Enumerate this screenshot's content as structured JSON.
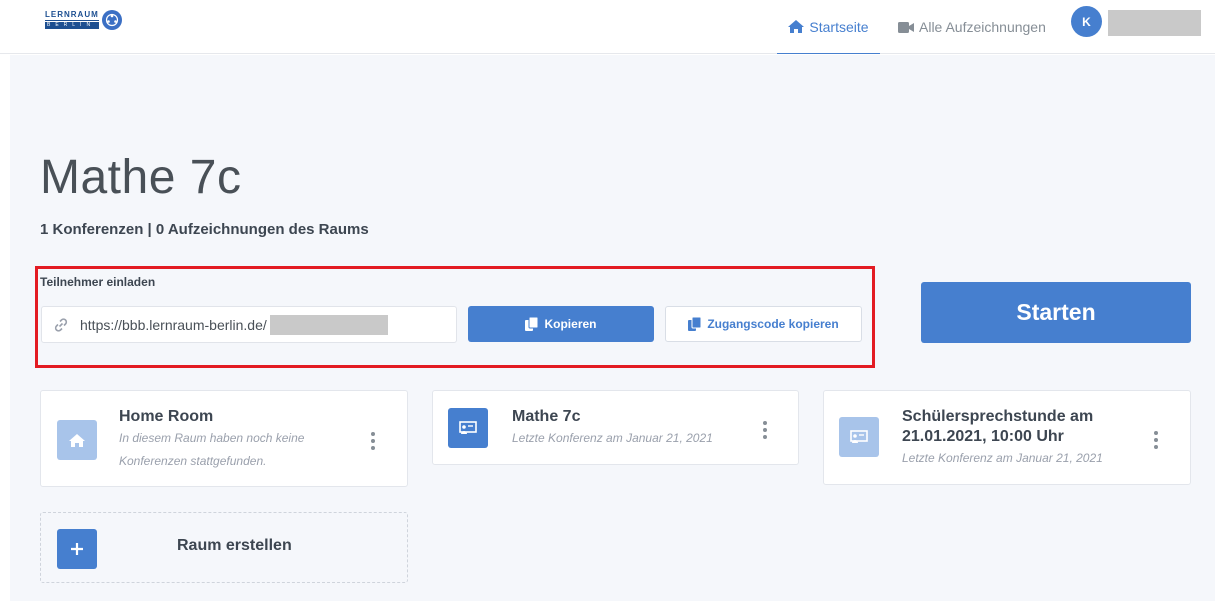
{
  "header": {
    "logo_main": "LERNRAUM",
    "logo_sub": "BERLIN",
    "nav_home_label": "Startseite",
    "nav_recordings_label": "Alle Aufzeichnungen",
    "avatar_initial": "K"
  },
  "room": {
    "title": "Mathe 7c",
    "subtitle": "1 Konferenzen | 0 Aufzeichnungen des Raums"
  },
  "invite": {
    "label": "Teilnehmer einladen",
    "url": "https://bbb.lernraum-berlin.de/",
    "copy_button": "Kopieren",
    "code_button": "Zugangscode kopieren"
  },
  "start_button": "Starten",
  "rooms": [
    {
      "title": "Home Room",
      "desc_line1": "In diesem Raum haben noch keine",
      "desc_line2": "Konferenzen stattgefunden.",
      "icon": "home-icon"
    },
    {
      "title": "Mathe 7c",
      "desc": "Letzte Konferenz am Januar 21, 2021",
      "icon": "presentation-icon"
    },
    {
      "title_line1": "Schülersprechstunde am",
      "title_line2": "21.01.2021, 10:00 Uhr",
      "desc": "Letzte Konferenz am Januar 21, 2021",
      "icon": "presentation-icon"
    }
  ],
  "create_room_label": "Raum erstellen",
  "colors": {
    "accent": "#467fcf",
    "highlight_border": "#e31b23",
    "background": "#f5f7fb"
  }
}
